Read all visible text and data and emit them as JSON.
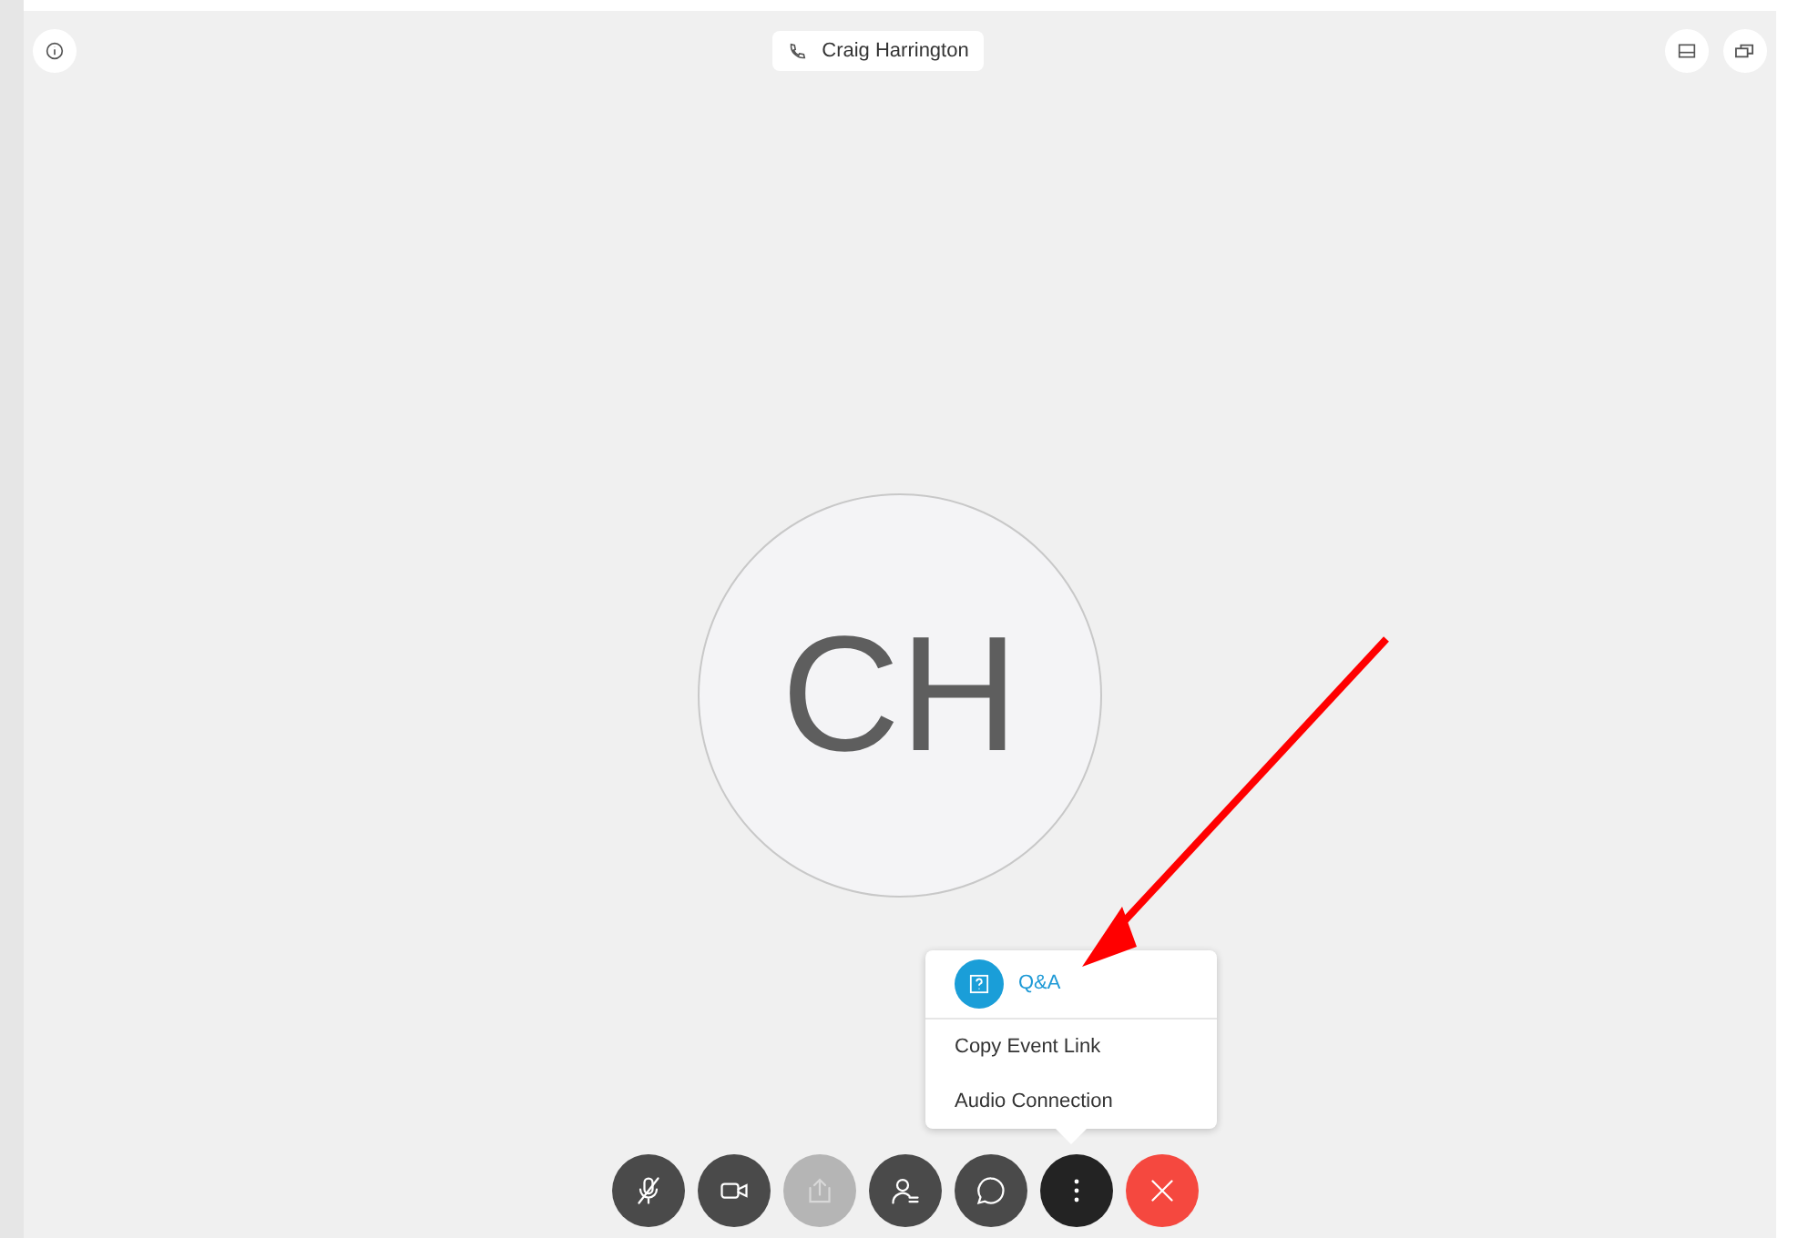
{
  "header": {
    "caller": "Craig Harrington"
  },
  "avatar": {
    "initials": "CH"
  },
  "menu": {
    "items": [
      {
        "label": "Q&A",
        "kind": "app",
        "highlighted": true
      },
      {
        "label": "Copy Event Link",
        "kind": "plain",
        "highlighted": false
      },
      {
        "label": "Audio Connection",
        "kind": "plain",
        "highlighted": false
      }
    ]
  },
  "controls": [
    {
      "kind": "mute",
      "disabled": false,
      "selected": false
    },
    {
      "kind": "video",
      "disabled": false,
      "selected": false
    },
    {
      "kind": "share",
      "disabled": true,
      "selected": false
    },
    {
      "kind": "participants",
      "disabled": false,
      "selected": false
    },
    {
      "kind": "chat",
      "disabled": false,
      "selected": false
    },
    {
      "kind": "more",
      "disabled": false,
      "selected": true
    },
    {
      "kind": "end",
      "disabled": false,
      "selected": false
    }
  ]
}
